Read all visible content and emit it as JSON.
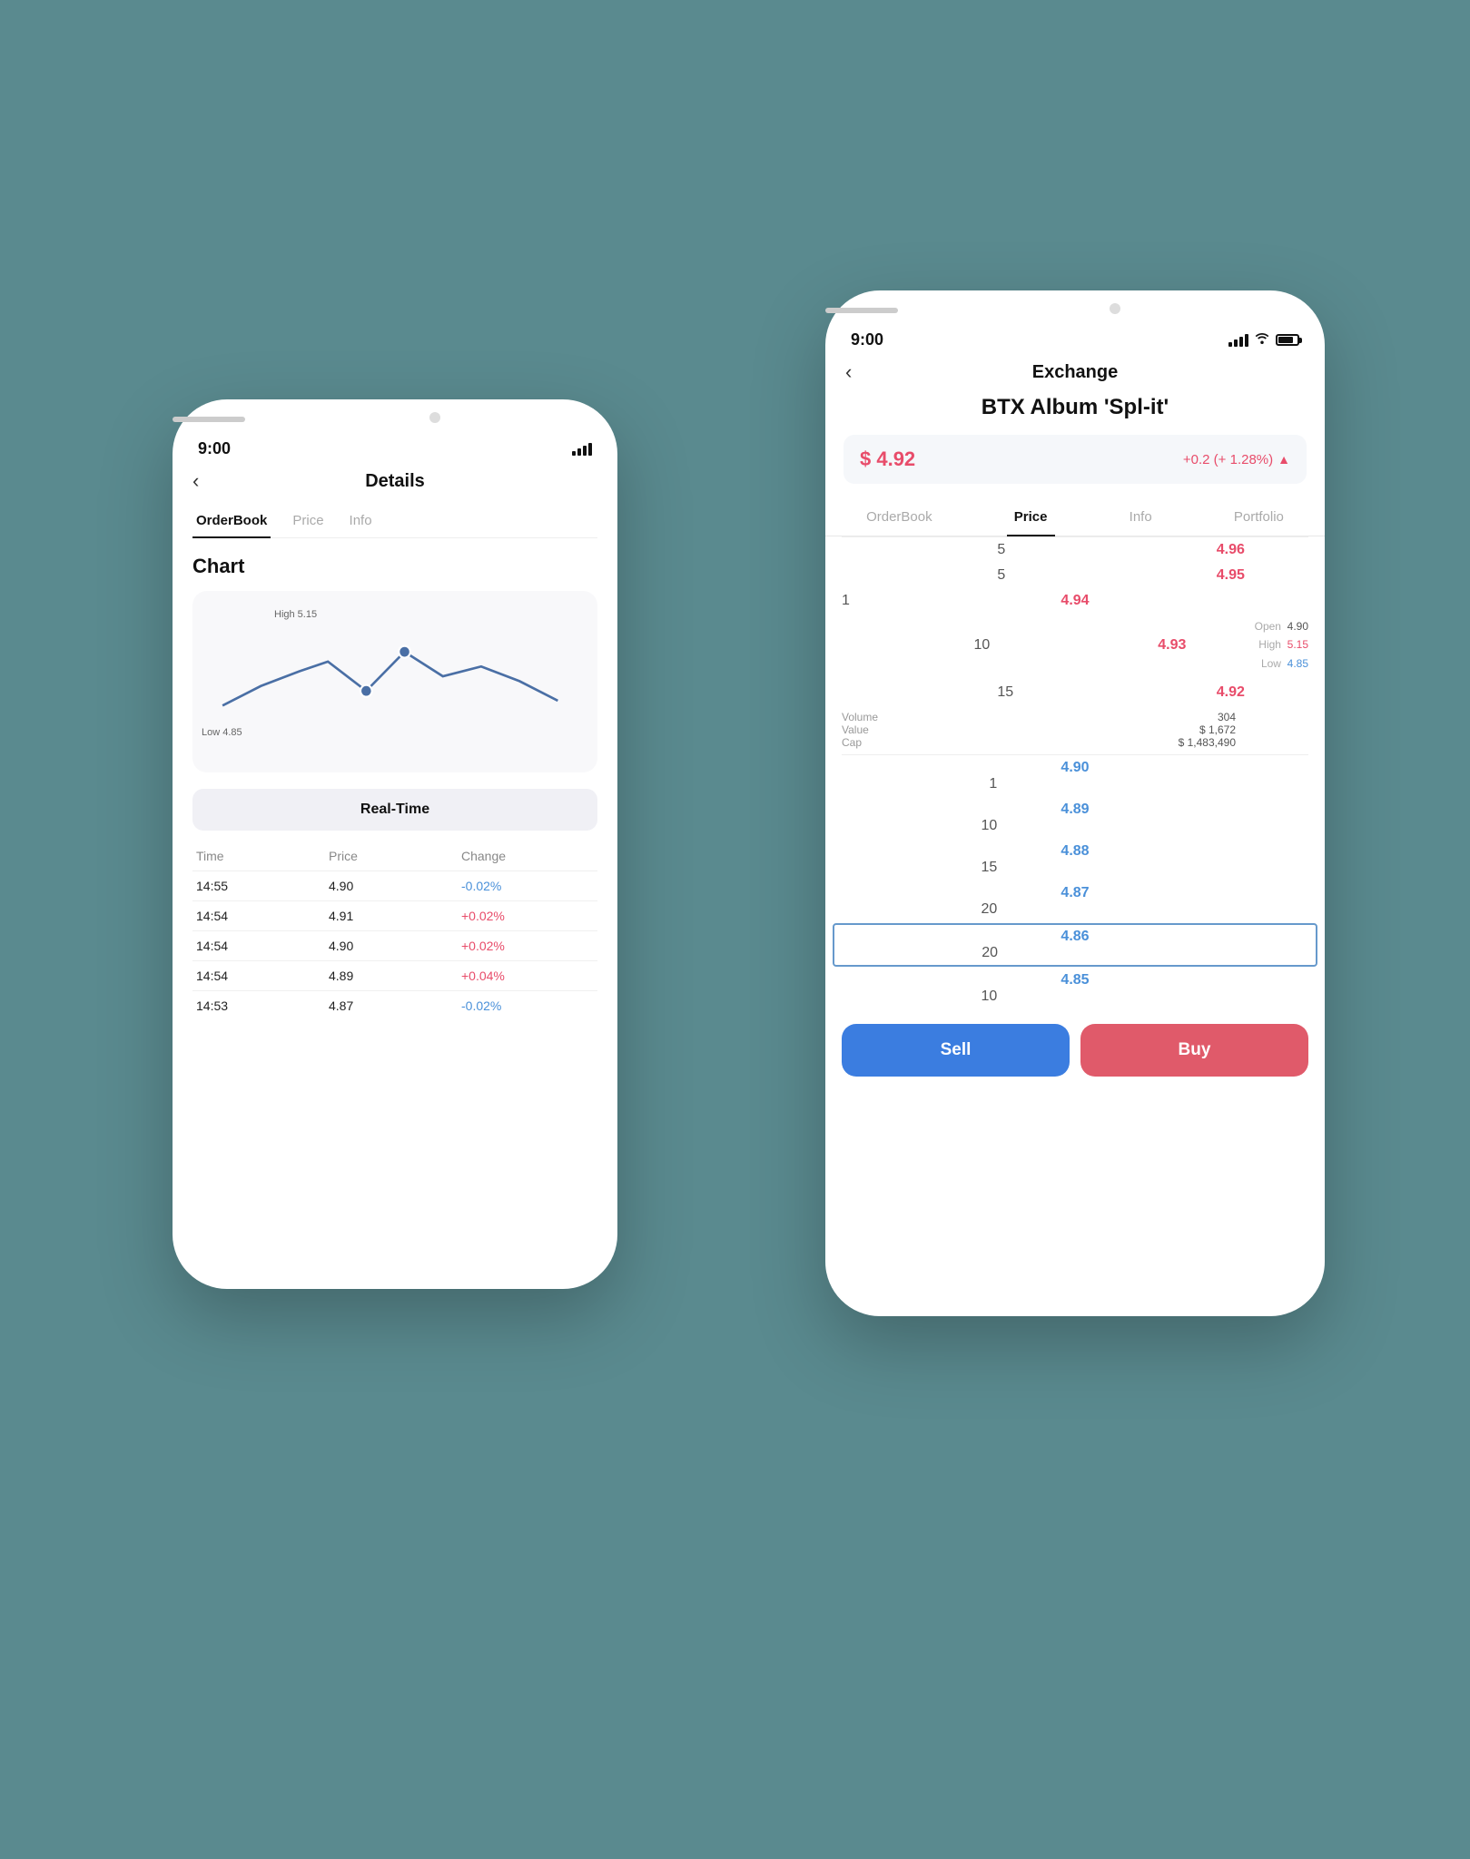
{
  "background_color": "#5a8a8f",
  "phone_back": {
    "time": "9:00",
    "title": "Details",
    "tabs": [
      "OrderBook",
      "Price",
      "Info"
    ],
    "active_tab": "OrderBook",
    "chart_title": "Chart",
    "chart_high_label": "High  5.15",
    "chart_low_label": "Low  4.85",
    "realtime_btn": "Real-Time",
    "trade_table": {
      "headers": [
        "Time",
        "Price",
        "Change"
      ],
      "rows": [
        {
          "time": "14:55",
          "price": "4.90",
          "change": "-0.02%",
          "type": "negative"
        },
        {
          "time": "14:54",
          "price": "4.91",
          "change": "+0.02%",
          "type": "positive"
        },
        {
          "time": "14:54",
          "price": "4.90",
          "change": "+0.02%",
          "type": "positive"
        },
        {
          "time": "14:54",
          "price": "4.89",
          "change": "+0.04%",
          "type": "positive"
        },
        {
          "time": "14:53",
          "price": "4.87",
          "change": "-0.02%",
          "type": "negative"
        }
      ]
    }
  },
  "phone_front": {
    "time": "9:00",
    "page_title": "Exchange",
    "asset_title": "BTX Album 'Spl-it'",
    "current_price": "$ 4.92",
    "price_change": "+0.2 (+ 1.28%)",
    "tabs": [
      "OrderBook",
      "Price",
      "Info",
      "Portfolio"
    ],
    "active_tab": "Price",
    "orderbook": {
      "asks": [
        {
          "qty_left": "5",
          "price": "4.96",
          "qty_right": ""
        },
        {
          "qty_left": "5",
          "price": "4.95",
          "qty_right": ""
        },
        {
          "qty_left": "1",
          "price": "4.94",
          "qty_right": ""
        },
        {
          "qty_left": "10",
          "price": "4.93",
          "qty_right": ""
        },
        {
          "qty_left": "15",
          "price": "4.92",
          "qty_right": ""
        }
      ],
      "bids": [
        {
          "qty_left": "",
          "price": "4.90",
          "qty_right": "1"
        },
        {
          "qty_left": "",
          "price": "4.89",
          "qty_right": "10"
        },
        {
          "qty_left": "",
          "price": "4.88",
          "qty_right": "15"
        },
        {
          "qty_left": "",
          "price": "4.87",
          "qty_right": "20"
        },
        {
          "qty_left": "",
          "price": "4.86",
          "qty_right": "20",
          "selected": true
        },
        {
          "qty_left": "",
          "price": "4.85",
          "qty_right": "10"
        }
      ],
      "stats": {
        "open_label": "Open",
        "open_value": "4.90",
        "high_label": "High",
        "high_value": "5.15",
        "low_label": "Low",
        "low_value": "4.85",
        "volume_label": "Volume",
        "volume_value": "304",
        "value_label": "Value",
        "value_value": "$ 1,672",
        "cap_label": "Cap",
        "cap_value": "$ 1,483,490"
      }
    },
    "sell_btn": "Sell",
    "buy_btn": "Buy"
  }
}
